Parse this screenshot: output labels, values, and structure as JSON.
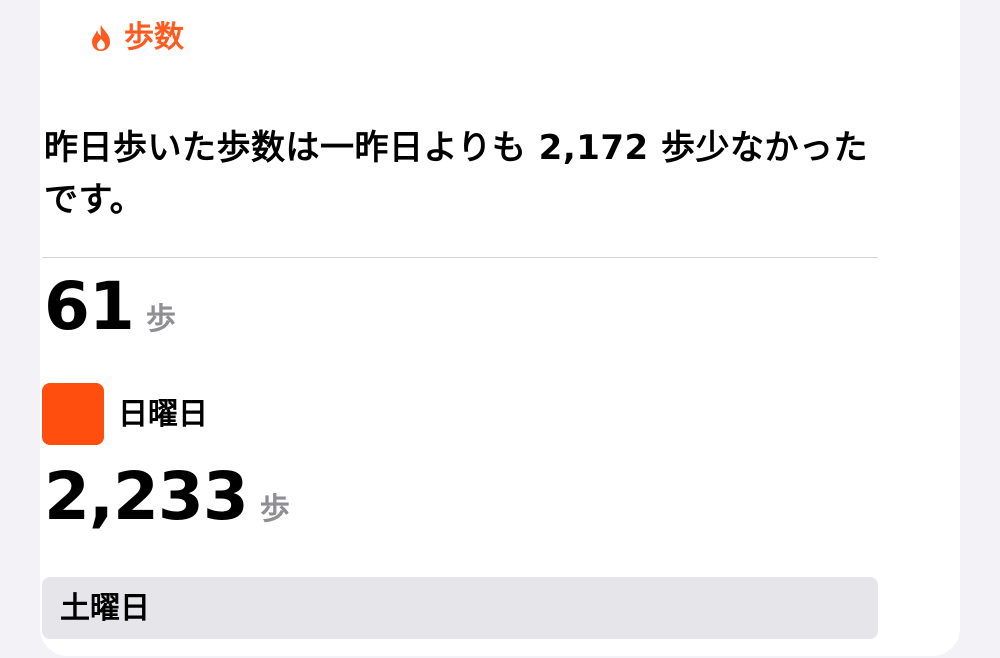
{
  "header": {
    "icon": "flame-icon",
    "label": "歩数",
    "accent_color": "#ff5a1f"
  },
  "summary": "昨日歩いた歩数は一昨日よりも 2,172 歩少なかったです。",
  "today": {
    "value": "61",
    "unit": "歩",
    "day_label": "日曜日",
    "bar_color": "#ff4e0e",
    "steps": 61
  },
  "previous": {
    "value": "2,233",
    "unit": "歩",
    "day_label": "土曜日",
    "bar_color": "#e5e5ea",
    "steps": 2233
  }
}
